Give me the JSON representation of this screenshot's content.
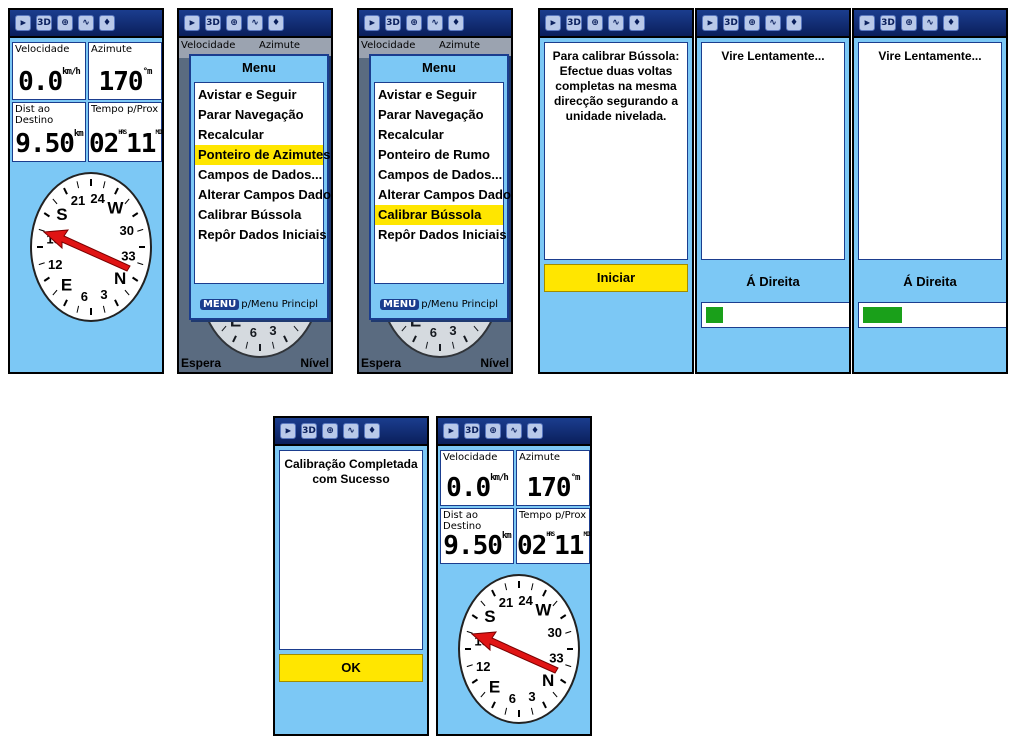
{
  "status_icons": [
    "gps-signal-icon",
    "3d-icon",
    "compass-icon",
    "track-icon",
    "waypoint-icon"
  ],
  "status_3d_label": "3D",
  "trip": {
    "speed_label": "Velocidade",
    "speed_value": "0.0",
    "speed_unit": "km/h",
    "heading_label": "Azimute",
    "heading_value": "170",
    "heading_unit": "°m",
    "dist_label": "Dist ao Destino",
    "dist_value": "9.50",
    "dist_unit": "km",
    "time_label": "Tempo p/Prox",
    "time_hours": "02",
    "time_hours_unit": "HRS",
    "time_minutes": "11",
    "time_minutes_unit": "MIN"
  },
  "compass": {
    "labels": [
      "24",
      "W",
      "30",
      "33",
      "N",
      "3",
      "6",
      "E",
      "12",
      "15",
      "S",
      "21"
    ],
    "bottom_left": "Espera",
    "bottom_right": "Nível"
  },
  "menu": {
    "title": "Menu",
    "hint_key": "MENU",
    "hint_text": "p/Menu Principl",
    "items_a": [
      "Avistar e Seguir",
      "Parar Navegação",
      "Recalcular",
      "Ponteiro de Azimutes",
      "Campos de Dados...",
      "Alterar Campos Dados",
      "Calibrar Bússola",
      "Repôr Dados Iniciais"
    ],
    "items_b": [
      "Avistar e Seguir",
      "Parar Navegação",
      "Recalcular",
      "Ponteiro de Rumo",
      "Campos de Dados...",
      "Alterar Campos Dados",
      "Calibrar Bússola",
      "Repôr Dados Iniciais"
    ],
    "selected_a": 3,
    "selected_b": 6
  },
  "calibration": {
    "instruction": "Para calibrar Bússola: Efectue duas voltas completas na mesma direcção segurando a unidade nivelada.",
    "start_button": "Iniciar",
    "turn_slowly": "Vire Lentamente...",
    "direction": "Á Direita",
    "progress_1": 0.12,
    "progress_2": 0.28,
    "complete_message": "Calibração Completada com Sucesso",
    "ok_button": "OK"
  }
}
